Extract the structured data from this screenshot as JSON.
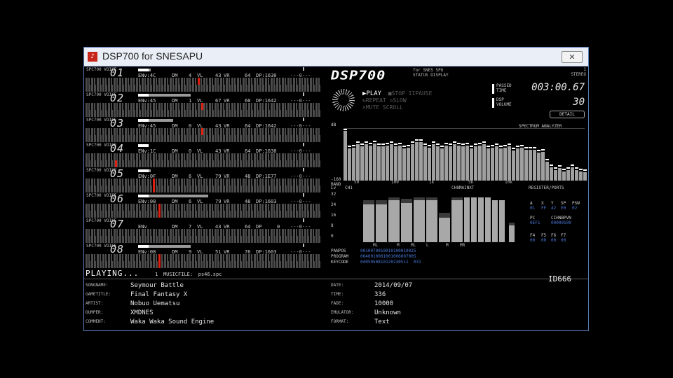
{
  "window": {
    "title": "DSP700 for SNESAPU",
    "close": "✕"
  },
  "channels": [
    {
      "num": "01",
      "info": {
        "env": "ENv:4C",
        "dm": "DM",
        "dmv": "4",
        "vl": "VL",
        "vlv": "43",
        "vr": "VR",
        "vrv": "64",
        "pitch": "DP:1630"
      },
      "knob": "---0---",
      "marker": "high"
    },
    {
      "num": "02",
      "info": {
        "env": "ENv:45",
        "dm": "DM",
        "dmv": "1",
        "vl": "VL",
        "vlv": "67",
        "vr": "VR",
        "vrv": "60",
        "pitch": "DP:1642"
      },
      "knob": "---0---",
      "marker": "high"
    },
    {
      "num": "03",
      "info": {
        "env": "ENv:45",
        "dm": "DM",
        "dmv": "0",
        "vl": "VL",
        "vlv": "43",
        "vr": "VR",
        "vrv": "64",
        "pitch": "DP:1642"
      },
      "knob": "---0---",
      "marker": "high"
    },
    {
      "num": "04",
      "info": {
        "env": "ENv:1C",
        "dm": "DM",
        "dmv": "0",
        "vl": "VL",
        "vlv": "43",
        "vr": "VR",
        "vrv": "64",
        "pitch": "DP:1630"
      },
      "knob": "---0---",
      "marker": "low"
    },
    {
      "num": "05",
      "info": {
        "env": "ENv:0F",
        "dm": "DM",
        "dmv": "6",
        "vl": "VL",
        "vlv": "79",
        "vr": "VR",
        "vrv": "48",
        "pitch": "DP:1E77"
      },
      "knob": "---0---",
      "marker": "full"
    },
    {
      "num": "06",
      "info": {
        "env": "ENv:08",
        "dm": "DM",
        "dmv": "6",
        "vl": "VL",
        "vlv": "79",
        "vr": "VR",
        "vrv": "48",
        "pitch": "DP:1603"
      },
      "knob": "---0---",
      "marker": "full"
    },
    {
      "num": "07",
      "info": {
        "env": "ENv",
        "dm": "DM",
        "dmv": "7",
        "vl": "VL",
        "vlv": "43",
        "vr": "VR",
        "vrv": "64",
        "pitch": "DP",
        "pv": "0"
      },
      "knob": "---0---",
      "marker": "none"
    },
    {
      "num": "08",
      "info": {
        "env": "ENv:08",
        "dm": "DM",
        "dmv": "9",
        "vl": "VL",
        "vlv": "51",
        "vr": "VR",
        "vrv": "76",
        "pitch": "DP:1603"
      },
      "knob": "---0---",
      "marker": "full"
    }
  ],
  "channel_word": "SPC700 VOICE",
  "playing": {
    "label": "PLAYING...",
    "count": "1",
    "file_label": "MUSICFILE:",
    "file": "ps46.spc"
  },
  "id_tag": "ID666",
  "meta_left": [
    {
      "key": "SONGNAME:",
      "value": "Seymour Battle"
    },
    {
      "key": "GAMETITLE:",
      "value": "Final Fantasy X"
    },
    {
      "key": "ARTIST:",
      "value": "Nobuo Uematsu"
    },
    {
      "key": "DUMPER:",
      "value": "XMDNES"
    },
    {
      "key": "COMMENT:",
      "value": "Waka Waka Sound Engine"
    }
  ],
  "meta_right": [
    {
      "key": "DATE:",
      "value": "2014/09/07"
    },
    {
      "key": "TIME:",
      "value": "336"
    },
    {
      "key": "FADE:",
      "value": "10000"
    },
    {
      "key": "EMULATOR:",
      "value": "Unknown"
    },
    {
      "key": "FORMAT:",
      "value": "Text"
    }
  ],
  "logo": "DSP700",
  "logo_sub": [
    "for SNES SPU",
    "STATUS DISPLAY"
  ],
  "top_right": [
    "1",
    "STEREO"
  ],
  "status": {
    "play": "PLAY",
    "stop": "STOP",
    "pause": "PAUSE",
    "repeat": "REPEAT",
    "slow": "SLOW",
    "mute": "MUTE",
    "scroll": "SCROLL"
  },
  "time": {
    "label1": "PASSED",
    "label2": "TIME",
    "value": "003:00.67",
    "vlabel1": "DSP",
    "vlabel2": "VOLUME",
    "volume": "30"
  },
  "button_small": "DETAIL",
  "spectrum": {
    "title": "SPECTRUM ANALYZER",
    "db": "dB",
    "floor": "-160",
    "band": "BAND",
    "xticks": [
      "50",
      "100",
      "1k",
      "5k",
      "10k"
    ],
    "levels": [
      0.96,
      0.62,
      0.64,
      0.7,
      0.66,
      0.7,
      0.68,
      0.72,
      0.66,
      0.66,
      0.68,
      0.7,
      0.66,
      0.68,
      0.62,
      0.64,
      0.7,
      0.74,
      0.74,
      0.66,
      0.64,
      0.7,
      0.66,
      0.62,
      0.68,
      0.66,
      0.7,
      0.68,
      0.66,
      0.68,
      0.62,
      0.66,
      0.68,
      0.7,
      0.62,
      0.64,
      0.66,
      0.62,
      0.64,
      0.66,
      0.58,
      0.62,
      0.64,
      0.6,
      0.6,
      0.6,
      0.54,
      0.56,
      0.36,
      0.26,
      0.2,
      0.24,
      0.18,
      0.2,
      0.26,
      0.2,
      0.18,
      0.16
    ]
  },
  "levels": {
    "lv": "Lv",
    "ch1": "CH1",
    "ch_right": "CH8MAINXT",
    "scale": [
      "32",
      "24",
      "16",
      "8",
      "0"
    ],
    "bars": [
      0.86,
      0.86,
      0.92,
      0.88,
      0.92,
      0.92,
      0.6,
      0.92,
      0.92,
      0.92,
      0.92,
      0.92,
      0.86,
      0.86,
      0.4
    ],
    "caps": [
      0.08,
      0.08,
      0.06,
      0.08,
      0.06,
      0.06,
      0.1,
      0.05,
      0.0,
      0.0,
      0.0,
      0.0,
      0.0,
      0.0,
      0.05
    ],
    "xlabels": [
      "ML",
      "M",
      "ML",
      "L",
      "M",
      "MR"
    ]
  },
  "registers": {
    "title": "REGISTER/PORTS",
    "row1h": [
      "A",
      "X",
      "Y",
      "SP",
      "PSW"
    ],
    "row1v": [
      "01",
      "FF",
      "42",
      "E0",
      "02"
    ],
    "row2h": [
      "PC",
      "",
      "CIHNBPVN"
    ],
    "row2v": [
      "0EF1",
      "",
      "00000100"
    ],
    "row3h": [
      "F4",
      "F5",
      "F6",
      "F7"
    ],
    "row3v": [
      "00",
      "00",
      "00",
      "00"
    ]
  },
  "table": [
    {
      "key": "PANPOS",
      "value": "0010070010010100010025"
    },
    {
      "key": "PROGRAM",
      "value": "0040010001001006007005"
    },
    {
      "key": "KEYCODE",
      "value": "0405050810120230511  031"
    }
  ]
}
